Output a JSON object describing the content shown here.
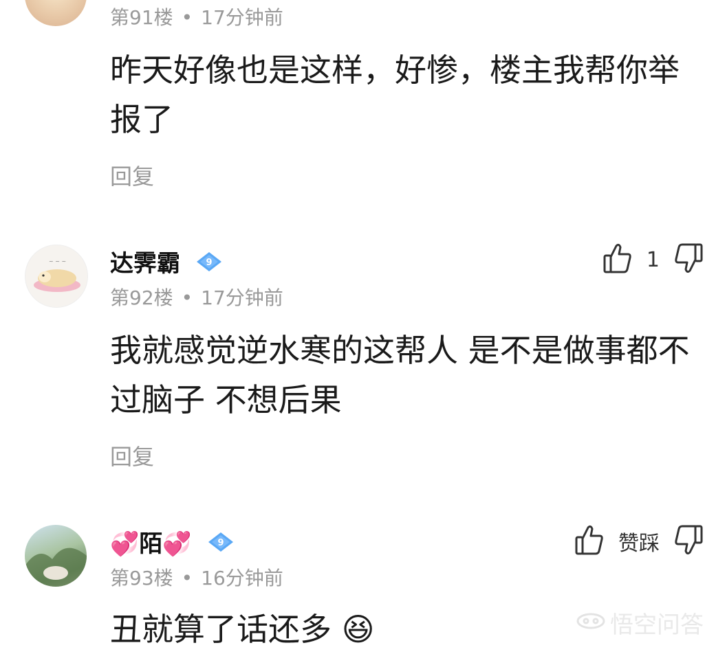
{
  "comments": [
    {
      "floor": "第91楼",
      "time": "17分钟前",
      "text": "昨天好像也是这样，好惨，楼主我帮你举报了",
      "reply_label": "回复"
    },
    {
      "username": "达霁霸",
      "level": "9",
      "floor": "第92楼",
      "time": "17分钟前",
      "likes": "1",
      "text": "我就感觉逆水寒的这帮人 是不是做事都不过脑子 不想后果",
      "reply_label": "回复"
    },
    {
      "username": "陌",
      "level": "9",
      "floor": "第93楼",
      "time": "16分钟前",
      "like_label": "赞踩",
      "text": "丑就算了话还多",
      "emoji": "😆"
    }
  ],
  "separator": "•",
  "watermark": "悟空问答"
}
